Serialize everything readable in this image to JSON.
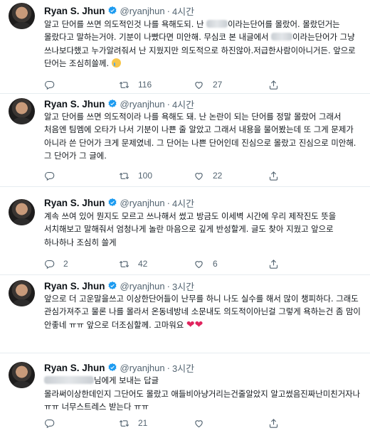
{
  "tweets": [
    {
      "name": "Ryan S. Jhun",
      "handle": "@ryanjhun",
      "time": "4시간",
      "text_1": "알고 단어를 쓰면 의도적인것 나를 욕해도되. 난 ",
      "text_2": "이라는단어를 몰랐어. 몰랐던거는 몰랐다고 말하는거야. 기분이 나빴다면 미안해. 무심코 본 내글에서 ",
      "text_3": "이라는단어가 그냥 쓰나보다했고 누가알려줘서 난 지웠지만 의도적으로 하진않아.저급한사람이아니거든.  앞으로 단어는 조심히쓸께.",
      "reply": "",
      "retweets": "116",
      "likes": "27"
    },
    {
      "name": "Ryan S. Jhun",
      "handle": "@ryanjhun",
      "time": "4시간",
      "text": "알고 단어를 쓰면 의도적이라 나를 욕해도 돼. 난 논란이 되는 단어를 정말 몰랐어 그래서 처음엔 팀멤에 오타가 나서 기분이 나쁜 줄 알았고 그래서 내용을 물어봤는데 또 그게 문제가 아니라 쓴 단어가 크게 문제였네. 그 단어는 나쁜 단어인데 진심으로 몰랐고 진심으로 미안해. 그 단어가 그 글에.",
      "reply": "",
      "retweets": "100",
      "likes": "22"
    },
    {
      "name": "Ryan S. Jhun",
      "handle": "@ryanjhun",
      "time": "4시간",
      "text": "계속 쓰여 있어 뭔지도 모르고 쓰나해서 썼고 방금도 이세벽 시간에 우리 제작진도 뜻을 서치해보고 말해줘서 엄청나게 놀란 마음으로 깊게 반성할게. 글도 찾아 지웠고 앞으로 하나하나 조심히 쓸게",
      "reply": "2",
      "retweets": "42",
      "likes": "6"
    },
    {
      "name": "Ryan S. Jhun",
      "handle": "@ryanjhun",
      "time": "3시간",
      "text": "앞으로 더 고운말을쓰고 이상한단어들이 난무를 하니 나도 실수를 해서 많이 챙피하다. 그래도 관심가져주고 물론 나를 몰라서 온동네방네 소문내도 의도적이아닌걸 그렇게 욕하는건 좀 맘이 안좋네 ㅠㅠ 앞으로 더조심할께. 고마워요",
      "hearts": "❤❤"
    },
    {
      "name": "Ryan S. Jhun",
      "handle": "@ryanjhun",
      "time": "3시간",
      "reply_to": "님에게 보내는 답글",
      "text": "몰라써이상한데인지 그단어도 몰랐고 애들비아냥거리는건줄알았지 알고썼음진짜난미친거자나 ㅠㅠ 너무스트레스 받는다 ㅠㅠ",
      "reply": "",
      "retweets": "21",
      "likes": ""
    }
  ],
  "colors": {
    "verified": "#1d9bf0",
    "heart": "#e0245e",
    "muted": "#536471"
  }
}
